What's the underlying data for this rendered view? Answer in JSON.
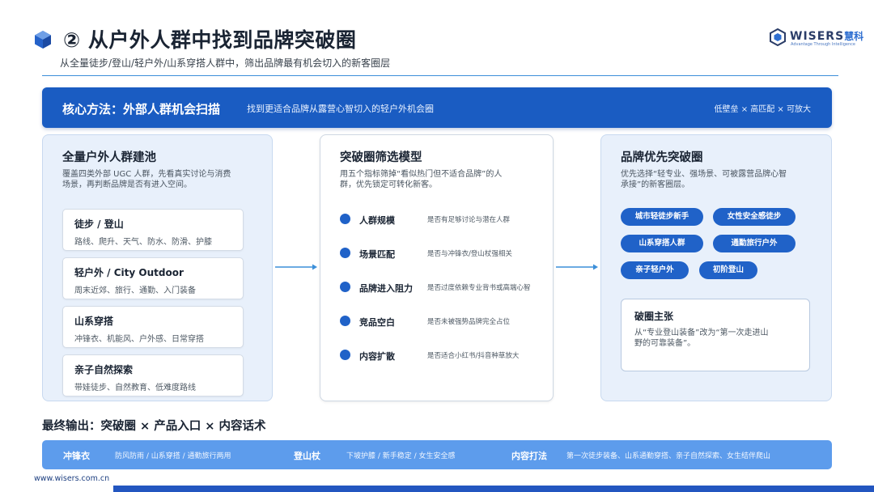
{
  "header": {
    "title": "② 从户外人群中找到品牌突破圈",
    "subtitle": "从全量徒步/登山/轻户外/山系穿搭人群中，筛出品牌最有机会切入的新客圈层",
    "logo": {
      "word": "WISERS",
      "cn": "慧科",
      "tagline": "Advantage Through Intelligence"
    }
  },
  "banner": {
    "title": "核心方法：外部人群机会扫描",
    "desc": "找到更适合品牌从露营心智切入的轻户外机会圈",
    "tag": "低壁垒 × 高匹配 × 可放大"
  },
  "left_panel": {
    "title": "全量户外人群建池",
    "desc_line1": "覆盖四类外部 UGC 人群，先看真实讨论与消费",
    "desc_line2": "场景，再判断品牌是否有进入空间。",
    "cards": [
      {
        "title": "徒步 / 登山",
        "desc": "路线、爬升、天气、防水、防滑、护膝"
      },
      {
        "title": "轻户外 / City Outdoor",
        "desc": "周末近郊、旅行、通勤、入门装备"
      },
      {
        "title": "山系穿搭",
        "desc": "冲锋衣、机能风、户外感、日常穿搭"
      },
      {
        "title": "亲子自然探索",
        "desc": "带娃徒步、自然教育、低难度路线"
      }
    ]
  },
  "mid_panel": {
    "title": "突破圈筛选模型",
    "desc_line1": "用五个指标筛掉“看似热门但不适合品牌”的人",
    "desc_line2": "群，优先锁定可转化新客。",
    "metrics": [
      {
        "label": "人群规模",
        "desc": "是否有足够讨论与潜在人群"
      },
      {
        "label": "场景匹配",
        "desc": "是否与冲锋衣/登山杖强相关"
      },
      {
        "label": "品牌进入阻力",
        "desc": "是否过度依赖专业背书或高端心智"
      },
      {
        "label": "竞品空白",
        "desc": "是否未被强势品牌完全占位"
      },
      {
        "label": "内容扩散",
        "desc": "是否适合小红书/抖音种草放大"
      }
    ]
  },
  "right_panel": {
    "title": "品牌优先突破圈",
    "desc_line1": "优先选择“轻专业、强场景、可被露营品牌心智",
    "desc_line2": "承接”的新客圈层。",
    "chips": [
      "城市轻徒步新手",
      "女性安全感徒步",
      "山系穿搭人群",
      "通勤旅行户外",
      "亲子轻户外",
      "初阶登山"
    ],
    "break_title": "破圈主张",
    "break_line1": "从“专业登山装备”改为“第一次走进山",
    "break_line2": "野的可靠装备”。"
  },
  "final_output": "最终输出：突破圈 × 产品入口 × 内容话术",
  "bottom_bar": {
    "items": [
      {
        "label": "冲锋衣",
        "text": "防风防雨 / 山系穿搭 / 通勤旅行两用"
      },
      {
        "label": "登山杖",
        "text": "下坡护膝 / 新手稳定 / 女生安全感"
      },
      {
        "label": "内容打法",
        "text": "第一次徒步装备、山系通勤穿搭、亲子自然探索、女生结伴爬山"
      }
    ]
  },
  "footer": {
    "url": "www.wisers.com.cn"
  },
  "colors": {
    "primary": "#1a5cc2",
    "accent": "#2062c8",
    "bar": "#5d9cec",
    "panel": "#e8f0fb"
  }
}
